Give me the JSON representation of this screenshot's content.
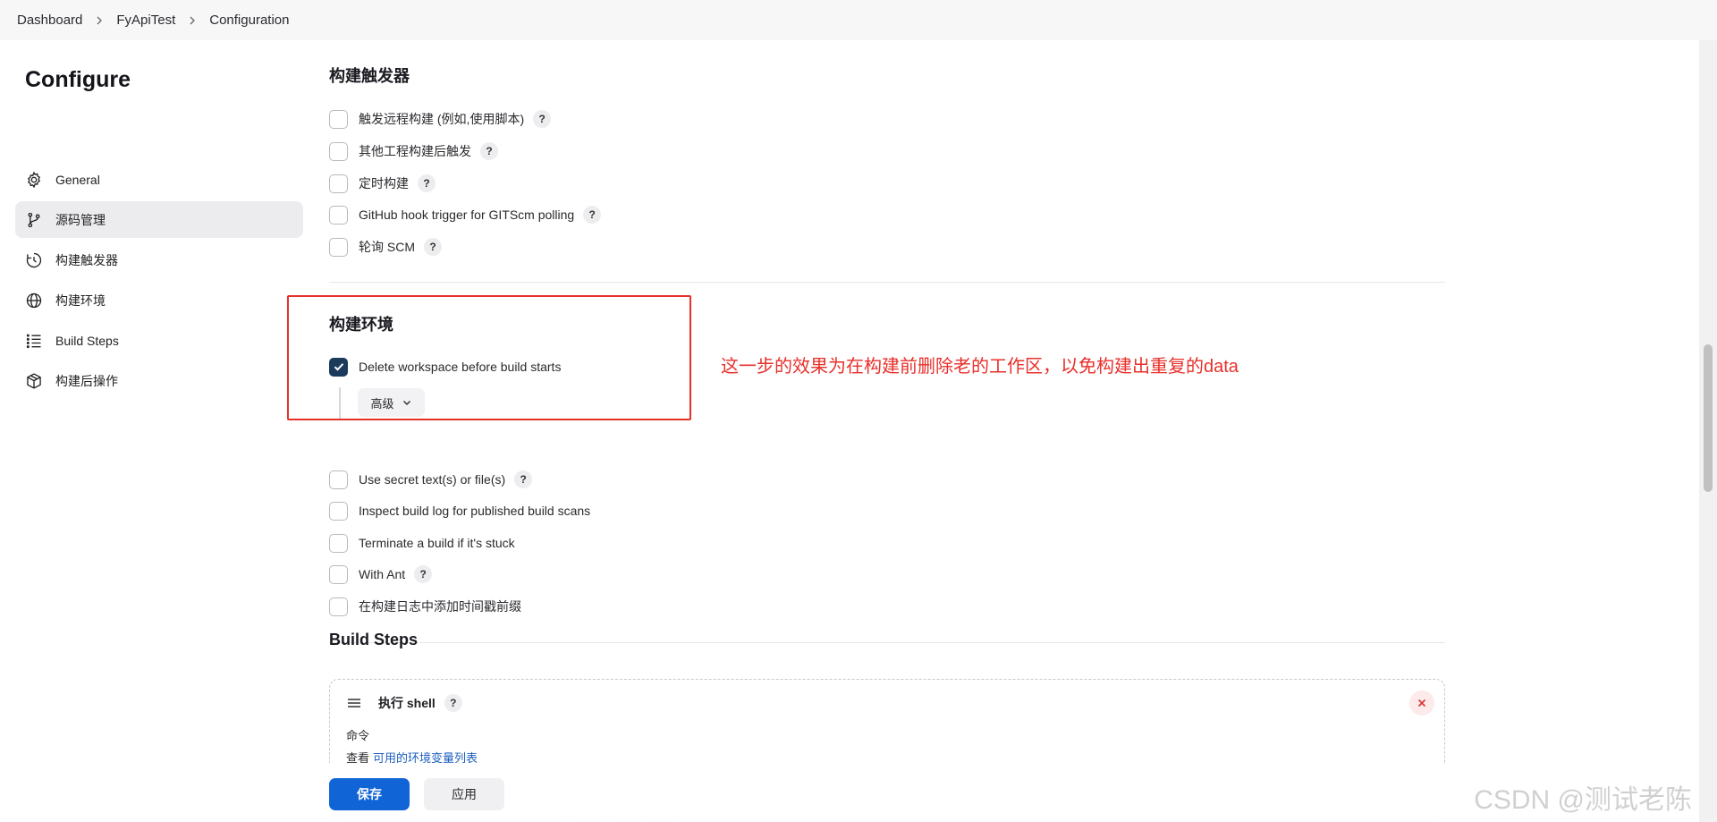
{
  "breadcrumb": [
    "Dashboard",
    "FyApiTest",
    "Configuration"
  ],
  "sidebar": {
    "title": "Configure",
    "items": [
      {
        "label": "General",
        "icon": "gear-icon",
        "active": false
      },
      {
        "label": "源码管理",
        "icon": "git-branch-icon",
        "active": true
      },
      {
        "label": "构建触发器",
        "icon": "clock-icon",
        "active": false
      },
      {
        "label": "构建环境",
        "icon": "globe-icon",
        "active": false
      },
      {
        "label": "Build Steps",
        "icon": "list-icon",
        "active": false
      },
      {
        "label": "构建后操作",
        "icon": "package-icon",
        "active": false
      }
    ]
  },
  "triggers": {
    "title": "构建触发器",
    "options": [
      {
        "label": "触发远程构建 (例如,使用脚本)",
        "checked": false,
        "help": true
      },
      {
        "label": "其他工程构建后触发",
        "checked": false,
        "help": true
      },
      {
        "label": "定时构建",
        "checked": false,
        "help": true
      },
      {
        "label": "GitHub hook trigger for GITScm polling",
        "checked": false,
        "help": true
      },
      {
        "label": "轮询 SCM",
        "checked": false,
        "help": true
      }
    ]
  },
  "build_env": {
    "title": "构建环境",
    "options": [
      {
        "label": "Delete workspace before build starts",
        "checked": true,
        "help": false
      },
      {
        "label": "Use secret text(s) or file(s)",
        "checked": false,
        "help": true
      },
      {
        "label": "Inspect build log for published build scans",
        "checked": false,
        "help": false
      },
      {
        "label": "Terminate a build if it's stuck",
        "checked": false,
        "help": false
      },
      {
        "label": "With Ant",
        "checked": false,
        "help": true
      },
      {
        "label": "在构建日志中添加时间戳前缀",
        "checked": false,
        "help": false
      }
    ],
    "advanced_label": "高级"
  },
  "annotation": "这一步的效果为在构建前删除老的工作区，以免构建出重复的data",
  "build_steps": {
    "title": "Build Steps",
    "step": {
      "title": "执行 shell",
      "command_label": "命令",
      "env_prefix": "查看",
      "env_link": "可用的环境变量列表"
    }
  },
  "footer": {
    "save_label": "保存",
    "apply_label": "应用",
    "watermark": "CSDN @测试老陈"
  },
  "help_glyph": "?",
  "colors": {
    "accent": "#1064d6",
    "checked": "#1b3a5c",
    "annotation": "#e8302b"
  }
}
